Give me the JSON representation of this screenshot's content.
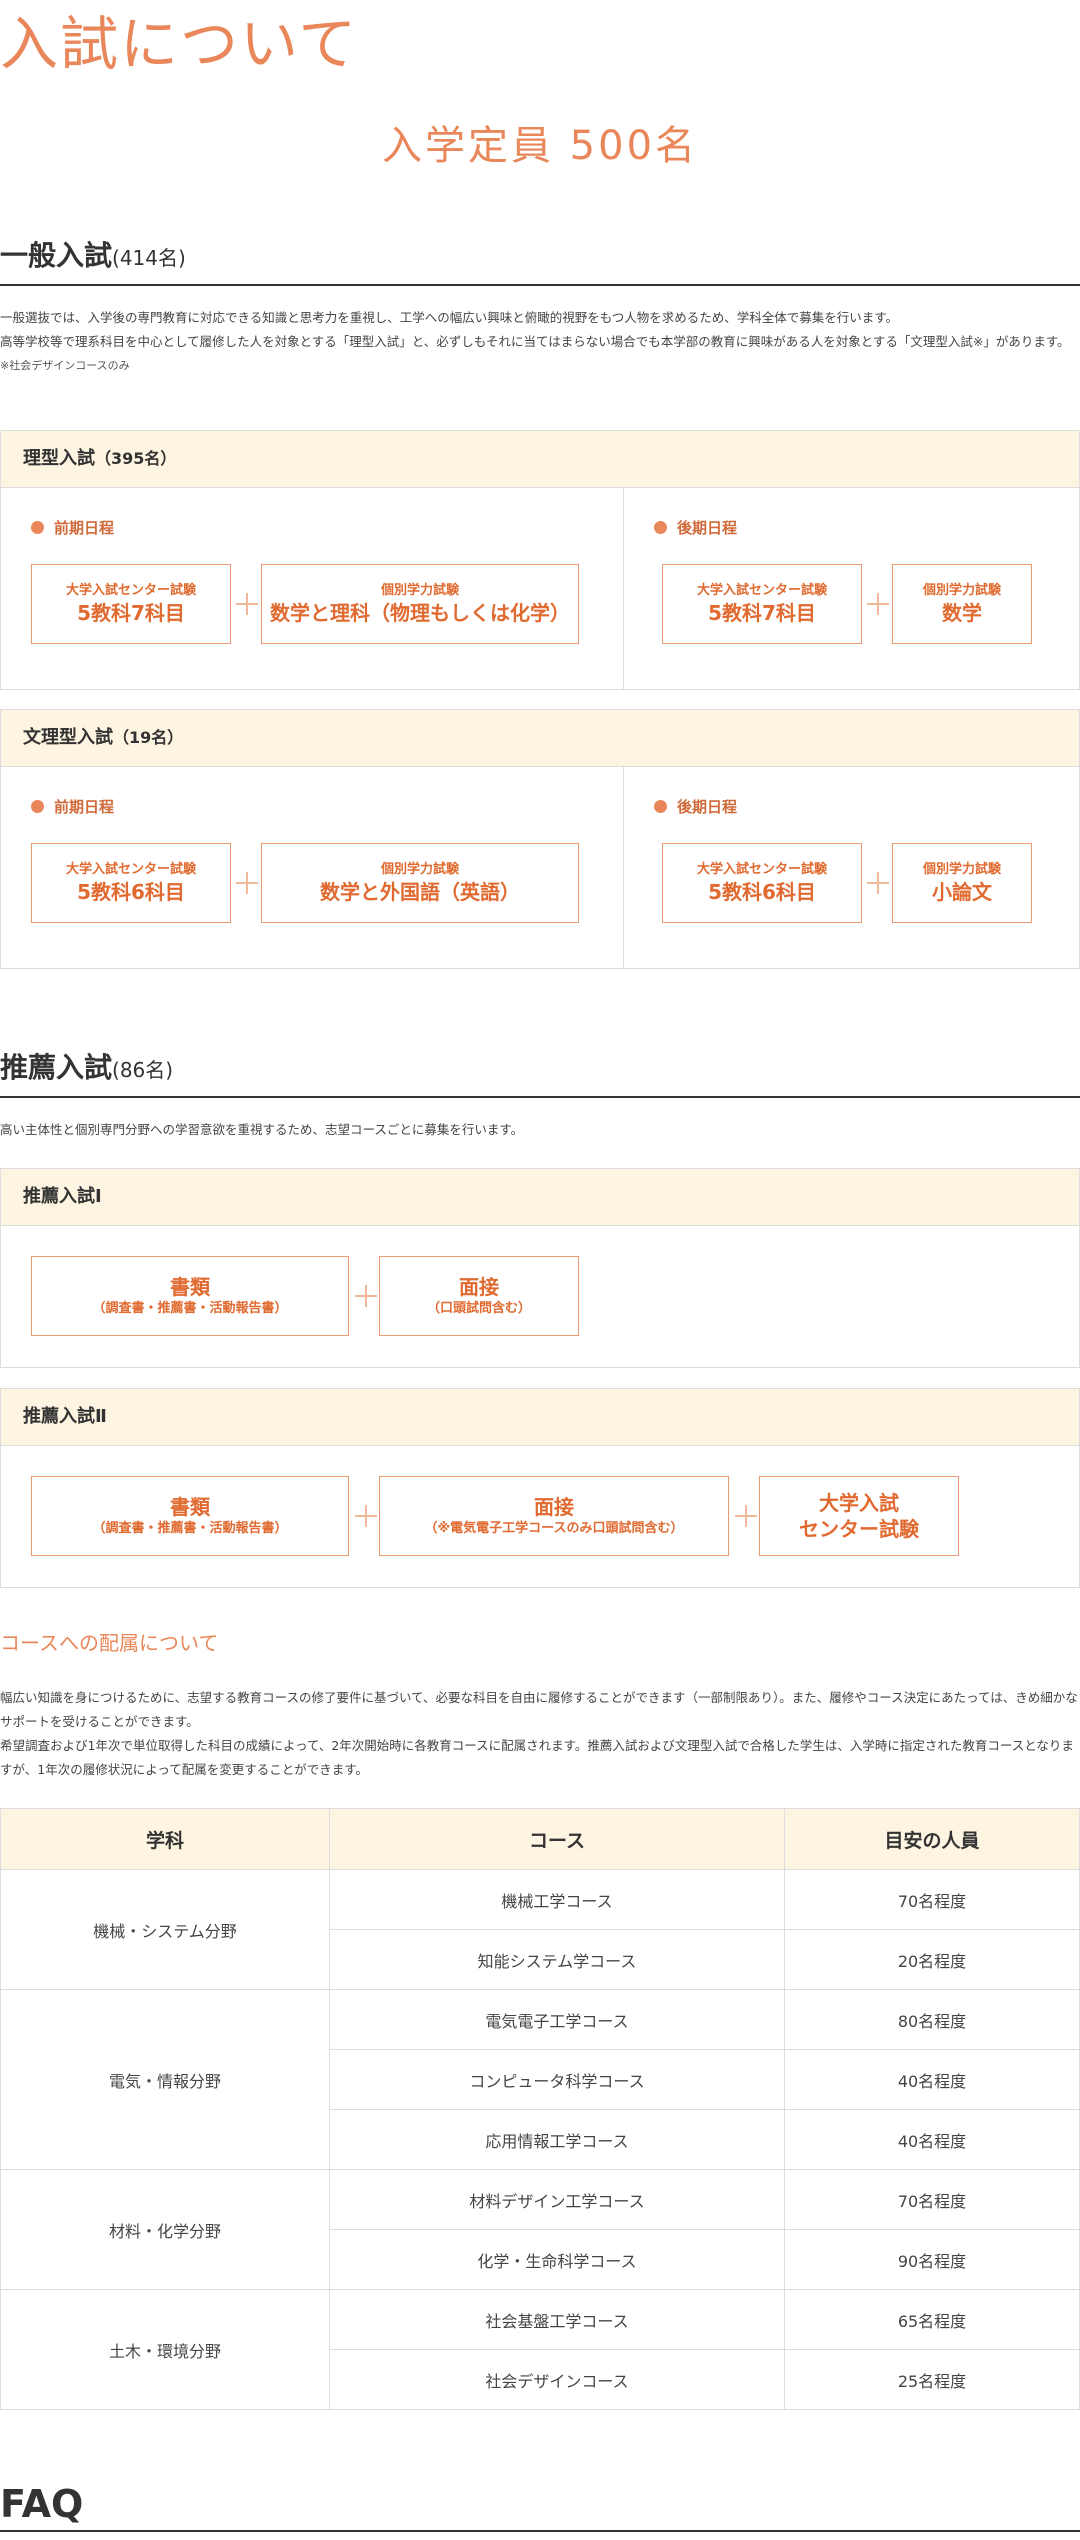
{
  "page": {
    "title": "入試について",
    "capacity": "入学定員 500名"
  },
  "general": {
    "heading": "一般入試",
    "count": "(414名)",
    "para1": "一般選抜では、入学後の専門教育に対応できる知識と思考力を重視し、工学への幅広い興味と俯瞰的視野をもつ人物を求めるため、学科全体で募集を行います。",
    "para2": "高等学校等で理系科目を中心として履修した人を対象とする「理型入試」と、必ずしもそれに当てはまらない場合でも本学部の教育に興味がある人を対象とする「文理型入試※」があります。",
    "note": "※社会デザインコースのみ",
    "science": {
      "title": "理型入試",
      "count": "（395名）",
      "early": {
        "label": "前期日程",
        "a_small": "大学入試センター試験",
        "a_big": "5教科7科目",
        "b_small": "個別学力試験",
        "b_big": "数学と理科（物理もしくは化学）"
      },
      "late": {
        "label": "後期日程",
        "a_small": "大学入試センター試験",
        "a_big": "5教科7科目",
        "b_small": "個別学力試験",
        "b_big": "数学"
      }
    },
    "liberal": {
      "title": "文理型入試",
      "count": "（19名）",
      "early": {
        "label": "前期日程",
        "a_small": "大学入試センター試験",
        "a_big": "5教科6科目",
        "b_small": "個別学力試験",
        "b_big": "数学と外国語（英語）"
      },
      "late": {
        "label": "後期日程",
        "a_small": "大学入試センター試験",
        "a_big": "5教科6科目",
        "b_small": "個別学力試験",
        "b_big": "小論文"
      }
    }
  },
  "recommend": {
    "heading": "推薦入試",
    "count": "(86名)",
    "para": "高い主体性と個別専門分野への学習意欲を重視するため、志望コースごとに募集を行います。",
    "r1": {
      "title": "推薦入試Ⅰ",
      "a_big": "書類",
      "a_small": "（調査書・推薦書・活動報告書）",
      "b_big": "面接",
      "b_small": "（口頭試問含む）"
    },
    "r2": {
      "title": "推薦入試Ⅱ",
      "a_big": "書類",
      "a_small": "（調査書・推薦書・活動報告書）",
      "b_big": "面接",
      "b_small": "（※電気電子工学コースのみ口頭試問含む）",
      "c_line1": "大学入試",
      "c_line2": "センター試験"
    }
  },
  "course": {
    "title": "コースへの配属について",
    "para1": "幅広い知識を身につけるために、志望する教育コースの修了要件に基づいて、必要な科目を自由に履修することができます（一部制限あり）。また、履修やコース決定にあたっては、きめ細かなサポートを受けることができます。",
    "para2": "希望調査および1年次で単位取得した科目の成績によって、2年次開始時に各教育コースに配属されます。推薦入試および文理型入試で合格した学生は、入学時に指定された教育コースとなりますが、1年次の履修状況によって配属を変更することができます。",
    "headers": [
      "学科",
      "コース",
      "目安の人員"
    ],
    "groups": [
      {
        "dept": "機械・システム分野",
        "rows": [
          [
            "機械工学コース",
            "70名程度"
          ],
          [
            "知能システム学コース",
            "20名程度"
          ]
        ]
      },
      {
        "dept": "電気・情報分野",
        "rows": [
          [
            "電気電子工学コース",
            "80名程度"
          ],
          [
            "コンピュータ科学コース",
            "40名程度"
          ],
          [
            "応用情報工学コース",
            "40名程度"
          ]
        ]
      },
      {
        "dept": "材料・化学分野",
        "rows": [
          [
            "材料デザイン工学コース",
            "70名程度"
          ],
          [
            "化学・生命科学コース",
            "90名程度"
          ]
        ]
      },
      {
        "dept": "土木・環境分野",
        "rows": [
          [
            "社会基盤工学コース",
            "65名程度"
          ],
          [
            "社会デザインコース",
            "25名程度"
          ]
        ]
      }
    ]
  },
  "faq": {
    "title": "FAQ"
  },
  "colors": {
    "accent": "#e9875a",
    "header_bg": "#fdf5e1",
    "border": "#dddddd"
  }
}
